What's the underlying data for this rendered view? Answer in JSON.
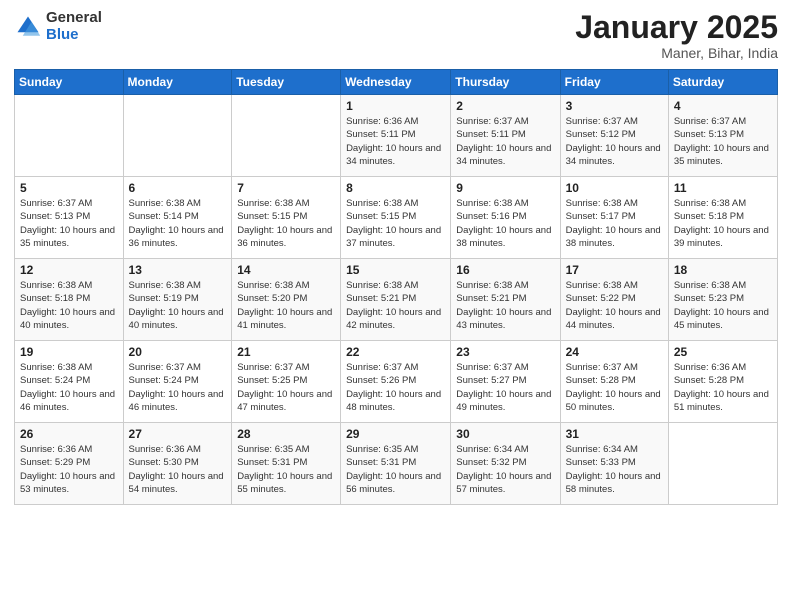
{
  "header": {
    "logo_general": "General",
    "logo_blue": "Blue",
    "month_title": "January 2025",
    "location": "Maner, Bihar, India"
  },
  "weekdays": [
    "Sunday",
    "Monday",
    "Tuesday",
    "Wednesday",
    "Thursday",
    "Friday",
    "Saturday"
  ],
  "weeks": [
    [
      {
        "day": "",
        "sunrise": "",
        "sunset": "",
        "daylight": ""
      },
      {
        "day": "",
        "sunrise": "",
        "sunset": "",
        "daylight": ""
      },
      {
        "day": "",
        "sunrise": "",
        "sunset": "",
        "daylight": ""
      },
      {
        "day": "1",
        "sunrise": "Sunrise: 6:36 AM",
        "sunset": "Sunset: 5:11 PM",
        "daylight": "Daylight: 10 hours and 34 minutes."
      },
      {
        "day": "2",
        "sunrise": "Sunrise: 6:37 AM",
        "sunset": "Sunset: 5:11 PM",
        "daylight": "Daylight: 10 hours and 34 minutes."
      },
      {
        "day": "3",
        "sunrise": "Sunrise: 6:37 AM",
        "sunset": "Sunset: 5:12 PM",
        "daylight": "Daylight: 10 hours and 34 minutes."
      },
      {
        "day": "4",
        "sunrise": "Sunrise: 6:37 AM",
        "sunset": "Sunset: 5:13 PM",
        "daylight": "Daylight: 10 hours and 35 minutes."
      }
    ],
    [
      {
        "day": "5",
        "sunrise": "Sunrise: 6:37 AM",
        "sunset": "Sunset: 5:13 PM",
        "daylight": "Daylight: 10 hours and 35 minutes."
      },
      {
        "day": "6",
        "sunrise": "Sunrise: 6:38 AM",
        "sunset": "Sunset: 5:14 PM",
        "daylight": "Daylight: 10 hours and 36 minutes."
      },
      {
        "day": "7",
        "sunrise": "Sunrise: 6:38 AM",
        "sunset": "Sunset: 5:15 PM",
        "daylight": "Daylight: 10 hours and 36 minutes."
      },
      {
        "day": "8",
        "sunrise": "Sunrise: 6:38 AM",
        "sunset": "Sunset: 5:15 PM",
        "daylight": "Daylight: 10 hours and 37 minutes."
      },
      {
        "day": "9",
        "sunrise": "Sunrise: 6:38 AM",
        "sunset": "Sunset: 5:16 PM",
        "daylight": "Daylight: 10 hours and 38 minutes."
      },
      {
        "day": "10",
        "sunrise": "Sunrise: 6:38 AM",
        "sunset": "Sunset: 5:17 PM",
        "daylight": "Daylight: 10 hours and 38 minutes."
      },
      {
        "day": "11",
        "sunrise": "Sunrise: 6:38 AM",
        "sunset": "Sunset: 5:18 PM",
        "daylight": "Daylight: 10 hours and 39 minutes."
      }
    ],
    [
      {
        "day": "12",
        "sunrise": "Sunrise: 6:38 AM",
        "sunset": "Sunset: 5:18 PM",
        "daylight": "Daylight: 10 hours and 40 minutes."
      },
      {
        "day": "13",
        "sunrise": "Sunrise: 6:38 AM",
        "sunset": "Sunset: 5:19 PM",
        "daylight": "Daylight: 10 hours and 40 minutes."
      },
      {
        "day": "14",
        "sunrise": "Sunrise: 6:38 AM",
        "sunset": "Sunset: 5:20 PM",
        "daylight": "Daylight: 10 hours and 41 minutes."
      },
      {
        "day": "15",
        "sunrise": "Sunrise: 6:38 AM",
        "sunset": "Sunset: 5:21 PM",
        "daylight": "Daylight: 10 hours and 42 minutes."
      },
      {
        "day": "16",
        "sunrise": "Sunrise: 6:38 AM",
        "sunset": "Sunset: 5:21 PM",
        "daylight": "Daylight: 10 hours and 43 minutes."
      },
      {
        "day": "17",
        "sunrise": "Sunrise: 6:38 AM",
        "sunset": "Sunset: 5:22 PM",
        "daylight": "Daylight: 10 hours and 44 minutes."
      },
      {
        "day": "18",
        "sunrise": "Sunrise: 6:38 AM",
        "sunset": "Sunset: 5:23 PM",
        "daylight": "Daylight: 10 hours and 45 minutes."
      }
    ],
    [
      {
        "day": "19",
        "sunrise": "Sunrise: 6:38 AM",
        "sunset": "Sunset: 5:24 PM",
        "daylight": "Daylight: 10 hours and 46 minutes."
      },
      {
        "day": "20",
        "sunrise": "Sunrise: 6:37 AM",
        "sunset": "Sunset: 5:24 PM",
        "daylight": "Daylight: 10 hours and 46 minutes."
      },
      {
        "day": "21",
        "sunrise": "Sunrise: 6:37 AM",
        "sunset": "Sunset: 5:25 PM",
        "daylight": "Daylight: 10 hours and 47 minutes."
      },
      {
        "day": "22",
        "sunrise": "Sunrise: 6:37 AM",
        "sunset": "Sunset: 5:26 PM",
        "daylight": "Daylight: 10 hours and 48 minutes."
      },
      {
        "day": "23",
        "sunrise": "Sunrise: 6:37 AM",
        "sunset": "Sunset: 5:27 PM",
        "daylight": "Daylight: 10 hours and 49 minutes."
      },
      {
        "day": "24",
        "sunrise": "Sunrise: 6:37 AM",
        "sunset": "Sunset: 5:28 PM",
        "daylight": "Daylight: 10 hours and 50 minutes."
      },
      {
        "day": "25",
        "sunrise": "Sunrise: 6:36 AM",
        "sunset": "Sunset: 5:28 PM",
        "daylight": "Daylight: 10 hours and 51 minutes."
      }
    ],
    [
      {
        "day": "26",
        "sunrise": "Sunrise: 6:36 AM",
        "sunset": "Sunset: 5:29 PM",
        "daylight": "Daylight: 10 hours and 53 minutes."
      },
      {
        "day": "27",
        "sunrise": "Sunrise: 6:36 AM",
        "sunset": "Sunset: 5:30 PM",
        "daylight": "Daylight: 10 hours and 54 minutes."
      },
      {
        "day": "28",
        "sunrise": "Sunrise: 6:35 AM",
        "sunset": "Sunset: 5:31 PM",
        "daylight": "Daylight: 10 hours and 55 minutes."
      },
      {
        "day": "29",
        "sunrise": "Sunrise: 6:35 AM",
        "sunset": "Sunset: 5:31 PM",
        "daylight": "Daylight: 10 hours and 56 minutes."
      },
      {
        "day": "30",
        "sunrise": "Sunrise: 6:34 AM",
        "sunset": "Sunset: 5:32 PM",
        "daylight": "Daylight: 10 hours and 57 minutes."
      },
      {
        "day": "31",
        "sunrise": "Sunrise: 6:34 AM",
        "sunset": "Sunset: 5:33 PM",
        "daylight": "Daylight: 10 hours and 58 minutes."
      },
      {
        "day": "",
        "sunrise": "",
        "sunset": "",
        "daylight": ""
      }
    ]
  ]
}
